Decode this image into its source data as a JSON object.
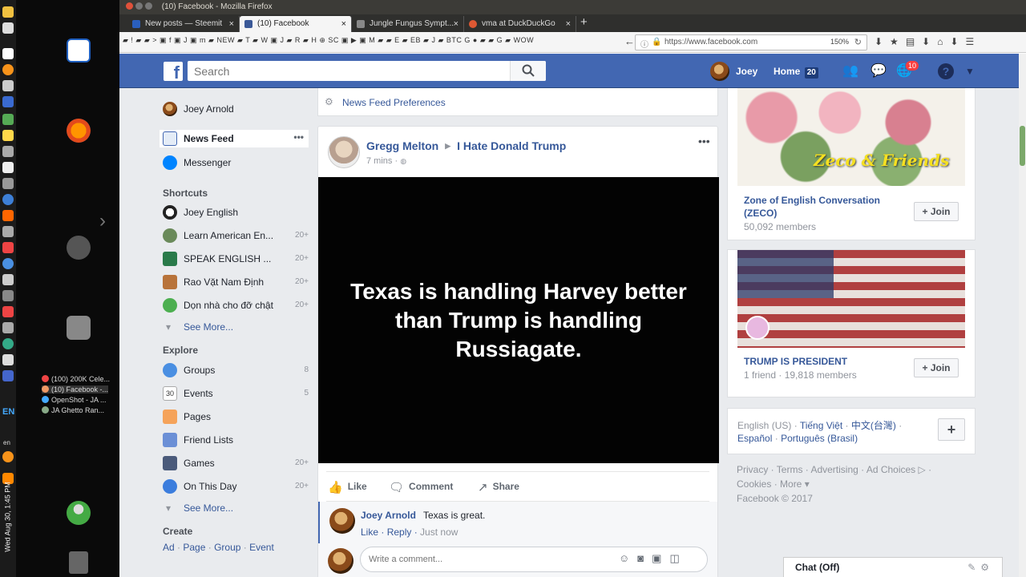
{
  "window": {
    "title": "(10) Facebook - Mozilla Firefox"
  },
  "tabs": [
    {
      "label": "New posts — Steemit",
      "color": "#2a5fbe"
    },
    {
      "label": "(10) Facebook",
      "color": "#3b5998"
    },
    {
      "label": "Jungle Fungus Sympt...",
      "color": "#888888"
    },
    {
      "label": "vma at DuckDuckGo",
      "color": "#de5833"
    }
  ],
  "toolbar": {
    "bookmarks": "▰ ! ▰ ▰ > ▣ f ▣ J ▣ m ▰ NEW ▰ T ▰ W ▣ J ▰ R ▰ H ⊕ SC ▣ ▶ ▣ M ▰ ▰ E ▰ EB ▰ J ▰ BTC G ● ▰ ▰ G ▰ WOW",
    "url": "https://www.facebook.com",
    "zoom": "150%"
  },
  "taskbar_items": [
    {
      "label": "(100) 200K Cele...",
      "color": "#e44"
    },
    {
      "label": "(10) Facebook -...",
      "color": "#e96"
    },
    {
      "label": "OpenShot - JA ...",
      "color": "#4af"
    },
    {
      "label": "JA Ghetto Ran...",
      "color": "#8a8"
    }
  ],
  "system": {
    "clock": "Wed Aug 30, 1:45 PM",
    "lang": "EN",
    "lang_small": "en"
  },
  "fb": {
    "search_placeholder": "Search",
    "user_name": "Joey",
    "home_label": "Home",
    "home_count": "20",
    "notifications_count": "10"
  },
  "left_nav": {
    "profile_name": "Joey Arnold",
    "news_feed": "News Feed",
    "messenger": "Messenger",
    "shortcuts_heading": "Shortcuts",
    "shortcuts": [
      {
        "label": "Joey English",
        "count": ""
      },
      {
        "label": "Learn American En...",
        "count": "20+"
      },
      {
        "label": "SPEAK ENGLISH ...",
        "count": "20+"
      },
      {
        "label": "Rao Vặt Nam Định",
        "count": "20+"
      },
      {
        "label": "Dọn nhà cho đỡ chật",
        "count": "20+"
      }
    ],
    "see_more": "See More...",
    "explore_heading": "Explore",
    "explore": [
      {
        "label": "Groups",
        "count": "8"
      },
      {
        "label": "Events",
        "count": "5"
      },
      {
        "label": "Pages",
        "count": ""
      },
      {
        "label": "Friend Lists",
        "count": ""
      },
      {
        "label": "Games",
        "count": "20+"
      },
      {
        "label": "On This Day",
        "count": "20+"
      }
    ],
    "events_day": "30",
    "create_heading": "Create",
    "create_links": [
      "Ad",
      "Page",
      "Group",
      "Event"
    ]
  },
  "feed": {
    "preferences": "News Feed Preferences",
    "post": {
      "author": "Gregg Melton",
      "group": "I Hate Donald Trump",
      "time": "7 mins ·",
      "media_text": "Texas is handling Harvey better than Trump is handling Russiagate.",
      "actions": {
        "like": "Like",
        "comment": "Comment",
        "share": "Share"
      },
      "comment": {
        "author": "Joey Arnold",
        "text": "Texas is great.",
        "like": "Like",
        "reply": "Reply",
        "time": "Just now"
      },
      "comment_placeholder": "Write a comment..."
    }
  },
  "right": {
    "group1": {
      "name": "Zone of English Conversation (ZECO)",
      "members": "50,092 members",
      "join": "Join",
      "banner_text": "Zeco & Friends"
    },
    "group2": {
      "name": "TRUMP IS PRESIDENT",
      "members": "1 friend · 19,818 members",
      "join": "Join"
    },
    "languages": {
      "current": "English (US)",
      "others_line1": [
        "Tiếng Việt",
        "中文(台灣)"
      ],
      "others_line2": [
        "Español",
        "Português (Brasil)"
      ]
    },
    "footer": {
      "line1": "Privacy · Terms · Advertising · Ad Choices ▷ ·",
      "line2": "Cookies · More ▾",
      "line3": "Facebook © 2017"
    },
    "chat": "Chat (Off)"
  }
}
